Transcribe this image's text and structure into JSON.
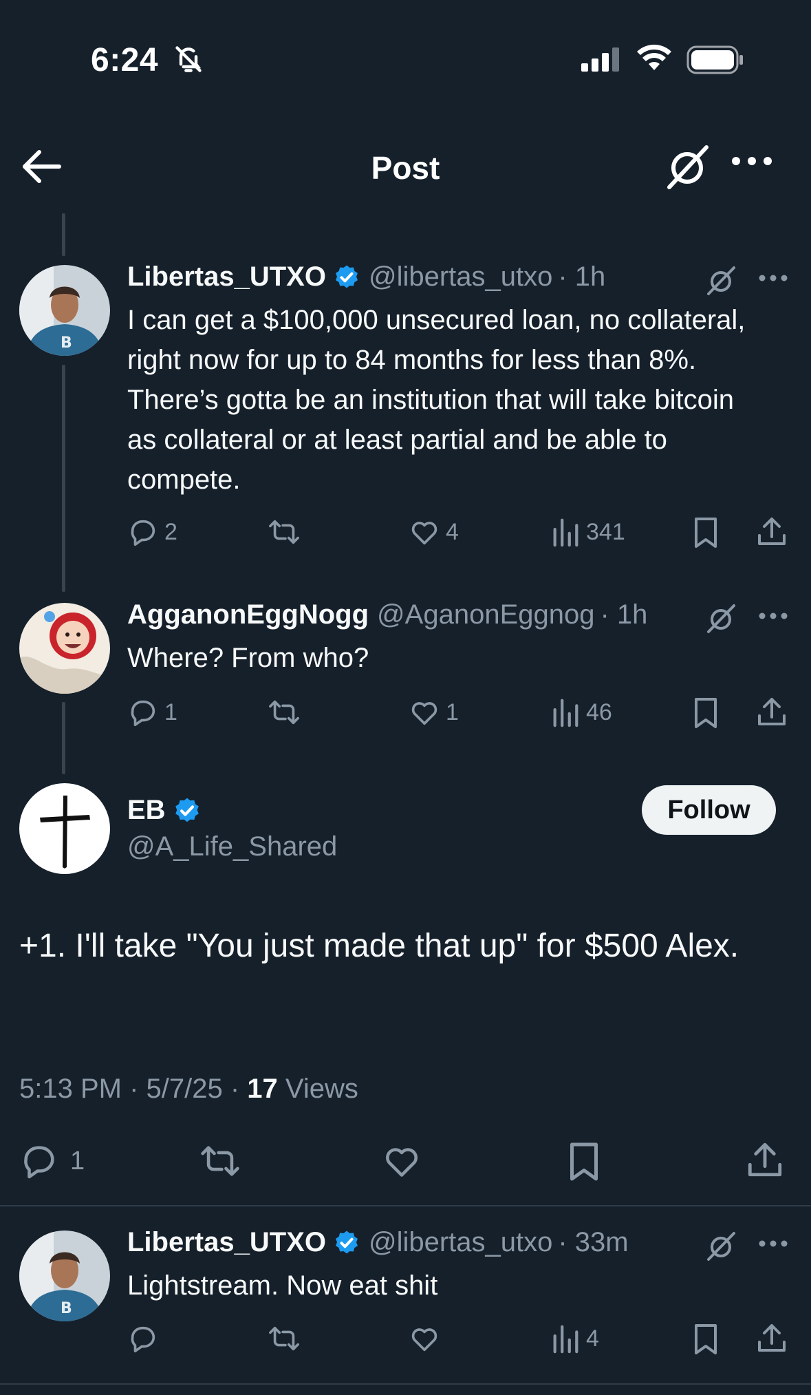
{
  "status_bar": {
    "time": "6:24"
  },
  "header": {
    "title": "Post"
  },
  "tweets": [
    {
      "username": "Libertas_UTXO",
      "handle": "@libertas_utxo",
      "time": "· 1h",
      "text": "I can get a $100,000 unsecured loan, no collateral, right now for up to 84 months for less than 8%. There’s gotta be an institution that will take bitcoin as collateral or at least partial and be able to compete.",
      "replies": "2",
      "retweets": "",
      "likes": "4",
      "views": "341"
    },
    {
      "username": "AgganonEggNogg",
      "handle": "@AganonEggnog",
      "time": "· 1h",
      "text": "Where? From who?",
      "replies": "1",
      "retweets": "",
      "likes": "1",
      "views": "46"
    }
  ],
  "main_post": {
    "username": "EB",
    "handle": "@A_Life_Shared",
    "follow_label": "Follow",
    "text": "+1. I'll take \"You just made that up\" for $500 Alex.",
    "timestamp": "5:13 PM · 5/7/25 · ",
    "views_count": "17",
    "views_label": " Views",
    "replies": "1"
  },
  "reply": {
    "username": "Libertas_UTXO",
    "handle": "@libertas_utxo",
    "time": "· 33m",
    "text": "Lightstream. Now eat shit",
    "views": "4"
  },
  "colors": {
    "background": "#15202b",
    "verified": "#1d9bf0",
    "muted": "#8b98a5"
  }
}
